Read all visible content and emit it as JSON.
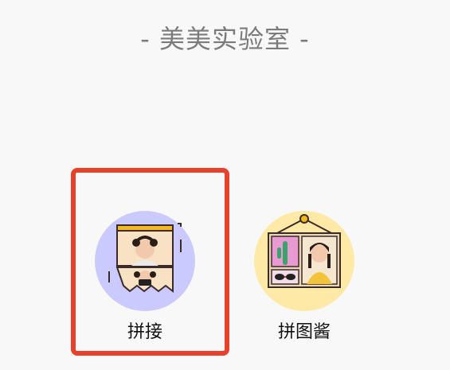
{
  "section": {
    "title": "- 美美实验室 -"
  },
  "tools": [
    {
      "label": "拼接",
      "icon": "photo-stitch-icon"
    },
    {
      "label": "拼图酱",
      "icon": "photo-collage-icon"
    }
  ],
  "colors": {
    "highlight": "#e8412b",
    "stitch_circle": "#cbcaff",
    "collage_circle": "#ffe9a6",
    "title": "#7b7b7b"
  }
}
